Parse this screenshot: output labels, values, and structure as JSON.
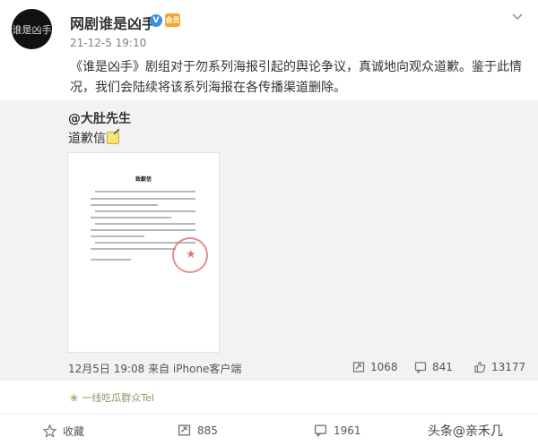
{
  "post": {
    "author": "网剧谁是凶手",
    "avatar_text": "谁是凶手",
    "verified_badge": "V",
    "vip_badge": "会员",
    "meta": "21-12-5 19:10",
    "content": "《谁是凶手》剧组对于勿系列海报引起的舆论争议，真诚地向观众道歉。鉴于此情况，我们会陆续将该系列海报在各传播渠道删除。"
  },
  "repost": {
    "author": "@大肚先生",
    "text": "道歉信",
    "letter_title": "致歉信",
    "meta": "12月5日 19:08 来自 iPhone客户端",
    "reposts": "1068",
    "comments": "841",
    "likes": "13177"
  },
  "fan_tag": "一线吃瓜群众Tel",
  "footer": {
    "reposts": "收藏",
    "comments": "885",
    "likes": "1961",
    "watermark": "头条@亲禾几"
  },
  "icons": [
    "chevron-down-icon",
    "repost-icon",
    "comment-icon",
    "like-icon",
    "star-icon"
  ],
  "colors": {
    "accent_blue": "#3a8ee6",
    "vip_orange": "#f8a32b",
    "repost_bg": "#f2f2f5",
    "stamp_red": "#d96a6a"
  }
}
